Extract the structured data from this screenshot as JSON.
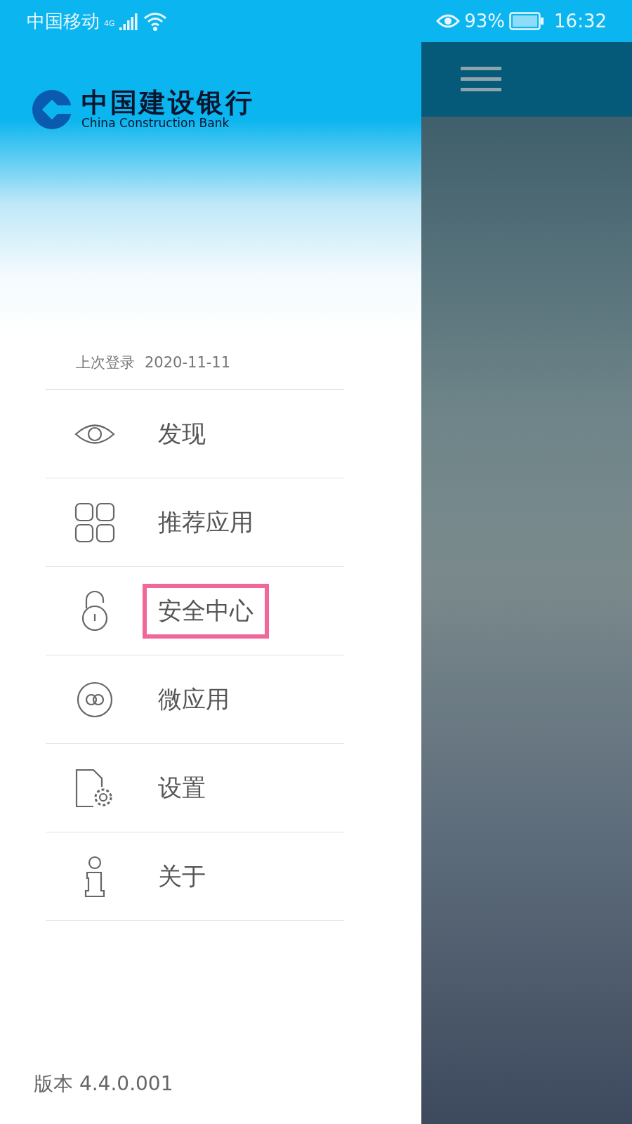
{
  "status_bar": {
    "carrier": "中国移动",
    "network": "4G",
    "battery": "93%",
    "time": "16:32"
  },
  "brand": {
    "name": "中国建设银行",
    "name_en": "China Construction Bank"
  },
  "last_login": {
    "label": "上次登录",
    "value": "2020-11-11"
  },
  "menu": [
    {
      "label": "发现",
      "highlighted": false
    },
    {
      "label": "推荐应用",
      "highlighted": false
    },
    {
      "label": "安全中心",
      "highlighted": true
    },
    {
      "label": "微应用",
      "highlighted": false
    },
    {
      "label": "设置",
      "highlighted": false
    },
    {
      "label": "关于",
      "highlighted": false
    }
  ],
  "version": "版本 4.4.0.001"
}
